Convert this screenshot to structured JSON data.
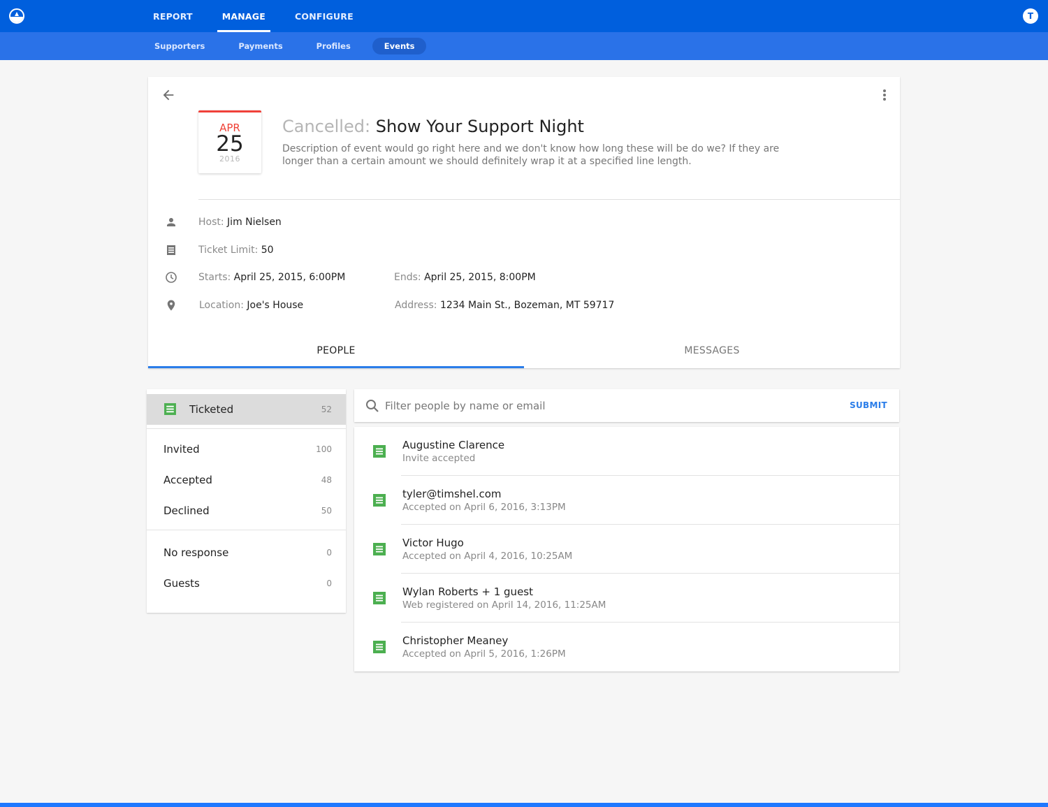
{
  "topbar": {
    "logo": "app-logo",
    "nav": [
      {
        "label": "REPORT",
        "active": false
      },
      {
        "label": "MANAGE",
        "active": true
      },
      {
        "label": "CONFIGURE",
        "active": false
      }
    ],
    "avatar_initial": "T"
  },
  "subnav": [
    {
      "label": "Supporters",
      "active": false
    },
    {
      "label": "Payments",
      "active": false
    },
    {
      "label": "Profiles",
      "active": false
    },
    {
      "label": "Events",
      "active": true
    }
  ],
  "event": {
    "date": {
      "month": "APR",
      "day": "25",
      "year": "2016"
    },
    "status": "Cancelled:",
    "title": "Show Your Support Night",
    "description": "Description of event would go right here and we don't know how long these will be do we? If they are longer than a certain amount we should definitely wrap it at a specified line length.",
    "details": {
      "host": {
        "label": "Host:",
        "value": "Jim Nielsen",
        "icon": "person-icon"
      },
      "ticket_limit": {
        "label": "Ticket Limit:",
        "value": "50",
        "icon": "ticket-icon"
      },
      "starts": {
        "label": "Starts:",
        "value": "April 25, 2015, 6:00PM",
        "icon": "clock-icon"
      },
      "ends": {
        "label": "Ends:",
        "value": "April 25, 2015, 8:00PM"
      },
      "location": {
        "label": "Location:",
        "value": "Joe's House",
        "icon": "location-pin-icon"
      },
      "address": {
        "label": "Address:",
        "value": "1234 Main St., Bozeman, MT 59717"
      }
    },
    "tabs": [
      {
        "label": "PEOPLE",
        "active": true
      },
      {
        "label": "MESSAGES",
        "active": false
      }
    ]
  },
  "filters": [
    {
      "label": "Ticketed",
      "count": "52",
      "active": true
    },
    {
      "label": "Invited",
      "count": "100"
    },
    {
      "label": "Accepted",
      "count": "48"
    },
    {
      "label": "Declined",
      "count": "50"
    },
    {
      "label": "No response",
      "count": "0"
    },
    {
      "label": "Guests",
      "count": "0"
    }
  ],
  "search": {
    "placeholder": "Filter people by name or email",
    "value": "",
    "submit_label": "SUBMIT"
  },
  "people": [
    {
      "name": "Augustine Clarence",
      "status": "Invite accepted"
    },
    {
      "name": "tyler@timshel.com",
      "status": "Accepted on April 6, 2016, 3:13PM"
    },
    {
      "name": "Victor Hugo",
      "status": "Accepted on April 4, 2016, 10:25AM"
    },
    {
      "name": "Wylan Roberts + 1 guest",
      "status": "Web registered on April 14, 2016, 11:25AM"
    },
    {
      "name": "Christopher Meaney",
      "status": "Accepted on April 5, 2016, 1:26PM"
    }
  ],
  "colors": {
    "primary": "#005fdd",
    "subnav": "#2a72e8",
    "accent": "#2a7de9",
    "cancelled_red": "#ef4136",
    "ticket_green": "#4caf50"
  }
}
